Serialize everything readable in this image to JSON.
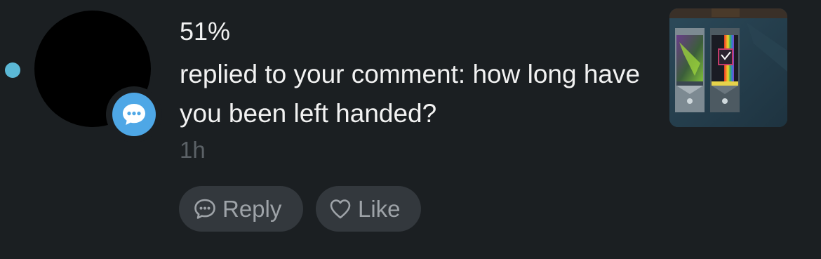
{
  "notification": {
    "username": "51%",
    "message": "replied to your comment: how long have you been left handed?",
    "timestamp": "1h",
    "unread": true,
    "badge_icon": "chat-bubble-icon",
    "thumbnail": "valorant-cards-thumbnail"
  },
  "actions": {
    "reply_label": "Reply",
    "like_label": "Like"
  },
  "colors": {
    "background": "#1b1f22",
    "unread_dot": "#5bb8d6",
    "badge": "#4ea7e6",
    "button_bg": "#33383d",
    "muted_text": "#5b6166"
  }
}
